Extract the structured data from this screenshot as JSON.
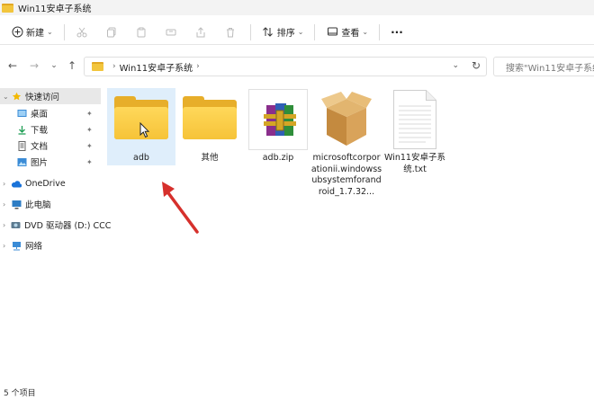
{
  "window": {
    "title": "Win11安卓子系统"
  },
  "toolbar": {
    "new_label": "新建",
    "sort_label": "排序",
    "view_label": "查看",
    "more_label": "···"
  },
  "address": {
    "crumb_sep": "›",
    "path": "Win11安卓子系统",
    "search_placeholder": "搜索\"Win11安卓子系统\""
  },
  "nav": {
    "quick_access": "快速访问",
    "desktop": "桌面",
    "downloads": "下载",
    "documents": "文档",
    "pictures": "图片",
    "onedrive": "OneDrive",
    "this_pc": "此电脑",
    "dvd": "DVD 驱动器 (D:) CCC",
    "network": "网络"
  },
  "files": [
    {
      "name": "adb",
      "type": "folder"
    },
    {
      "name": "其他",
      "type": "folder"
    },
    {
      "name": "adb.zip",
      "type": "archive"
    },
    {
      "name": "microsoftcorporationii.windowssubsystemforandroid_1.7.32...",
      "type": "package"
    },
    {
      "name": "Win11安卓子系统.txt",
      "type": "text"
    }
  ],
  "status": {
    "count": "5 个项目"
  },
  "colors": {
    "folder": "#f6c338",
    "selection": "#dfeefb",
    "arrow": "#d6302c"
  }
}
